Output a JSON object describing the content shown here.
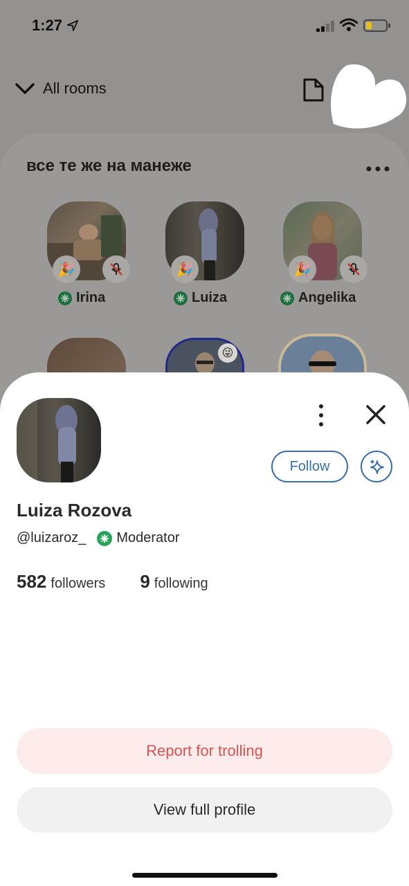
{
  "status_bar": {
    "time": "1:27",
    "battery_level": 0.3
  },
  "header": {
    "rooms_label": "All rooms"
  },
  "room": {
    "title": "все те же на манеже",
    "speakers": [
      {
        "name": "Irina",
        "badge_icon": "party-popper-icon",
        "muted": true
      },
      {
        "name": "Luiza",
        "badge_icon": "party-popper-icon",
        "muted": false
      },
      {
        "name": "Angelika",
        "badge_icon": "party-popper-icon",
        "muted": true
      }
    ]
  },
  "profile": {
    "full_name": "Luiza Rozova",
    "handle": "@luizaroz_",
    "role": "Moderator",
    "followers_count": "582",
    "followers_label": "followers",
    "following_count": "9",
    "following_label": "following",
    "follow_label": "Follow"
  },
  "actions": {
    "report_label": "Report for trolling",
    "view_profile_label": "View full profile"
  },
  "colors": {
    "accent_blue": "#3b6ea8",
    "moderator_green": "#2aa35a",
    "report_red": "#d9534f",
    "report_bg": "#fdeceb"
  }
}
